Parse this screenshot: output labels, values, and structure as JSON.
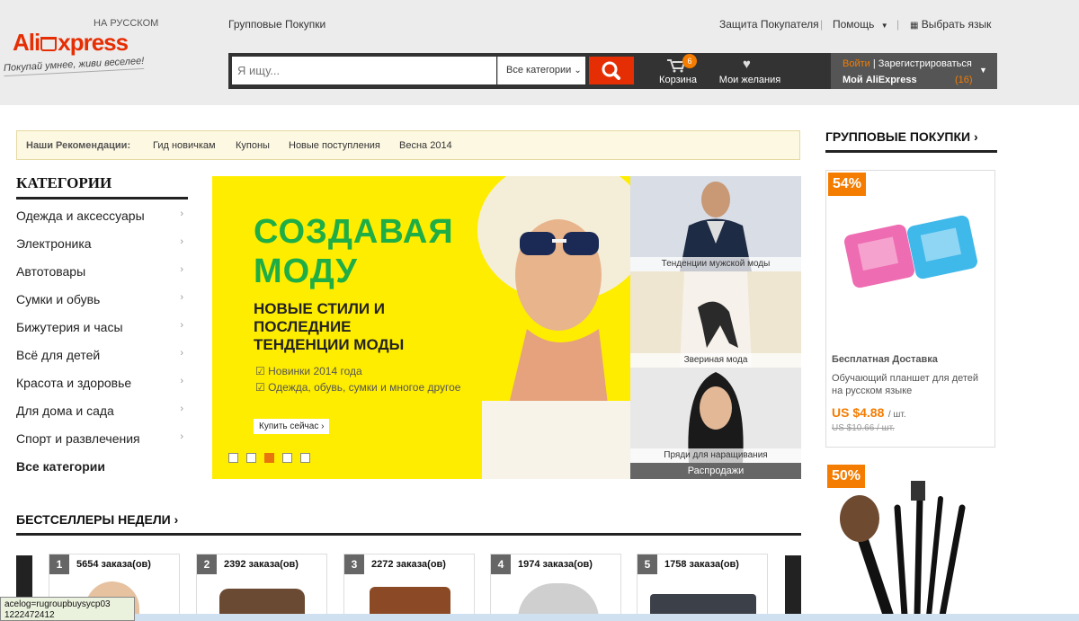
{
  "header": {
    "logo_lang": "НА РУССКОМ",
    "logo_ali": "Ali",
    "logo_express": "xpress",
    "slogan": "Покупай умнее, живи веселее!",
    "group_buy_link": "Групповые Покупки",
    "buyer_protection": "Защита Покупателя",
    "help": "Помощь",
    "language": "Выбрать язык",
    "search": {
      "placeholder": "Я ищу...",
      "category": "Все категории"
    },
    "cart": {
      "label": "Корзина",
      "count": "6"
    },
    "wishlist": {
      "label": "Мои желания"
    },
    "account": {
      "signin": "Войти",
      "register": "Зарегистрироваться",
      "my": "Мой AliExpress",
      "count": "(16)"
    }
  },
  "recommend": {
    "label": "Наши Рекомендации:",
    "items": [
      "Гид новичкам",
      "Купоны",
      "Новые поступления",
      "Весна 2014"
    ]
  },
  "categories": {
    "title": "КАТЕГОРИИ",
    "items": [
      "Одежда и аксессуары",
      "Электроника",
      "Автотовары",
      "Сумки и обувь",
      "Бижутерия и часы",
      "Всё для детей",
      "Красота и здоровье",
      "Для дома и сада",
      "Спорт и развлечения"
    ],
    "all": "Все категории"
  },
  "banner": {
    "headline1": "СОЗДАВАЯ",
    "headline2": "МОДУ",
    "sub1": "НОВЫЕ СТИЛИ И",
    "sub2": "ПОСЛЕДНИЕ",
    "sub3": "ТЕНДЕНЦИИ МОДЫ",
    "bullet1": "Новинки 2014 года",
    "bullet2": "Одежда, обувь, сумки и многое другое",
    "button": "Купить сейчас ›",
    "active_slide": 3,
    "slides": 5
  },
  "side_tiles": [
    "Тенденции мужской моды",
    "Звериная мода",
    "Пряди для наращивания",
    "Распродажи"
  ],
  "bestsellers": {
    "title": "БЕСТСЕЛЛЕРЫ НЕДЕЛИ",
    "items": [
      {
        "rank": "1",
        "orders": "5654 заказа(ов)"
      },
      {
        "rank": "2",
        "orders": "2392 заказа(ов)"
      },
      {
        "rank": "3",
        "orders": "2272 заказа(ов)"
      },
      {
        "rank": "4",
        "orders": "1974 заказа(ов)"
      },
      {
        "rank": "5",
        "orders": "1758 заказа(ов)"
      }
    ]
  },
  "group_deals": {
    "title": "ГРУППОВЫЕ ПОКУПКИ",
    "deal1": {
      "discount": "54%",
      "shipping": "Бесплатная Доставка",
      "name": "Обучающий планшет для детей на русском языке",
      "price": "US $4.88",
      "unit": "/ шт.",
      "old_price": "US $10.66 / шт."
    },
    "deal2": {
      "discount": "50%"
    }
  },
  "statusbar": {
    "url": "acelog=rugroupbuysycp03",
    "extra": "1222472412"
  },
  "colors": {
    "brand": "#e62e04",
    "accent": "#f47c00",
    "banner": "#ffed00",
    "headline": "#1fae45"
  }
}
